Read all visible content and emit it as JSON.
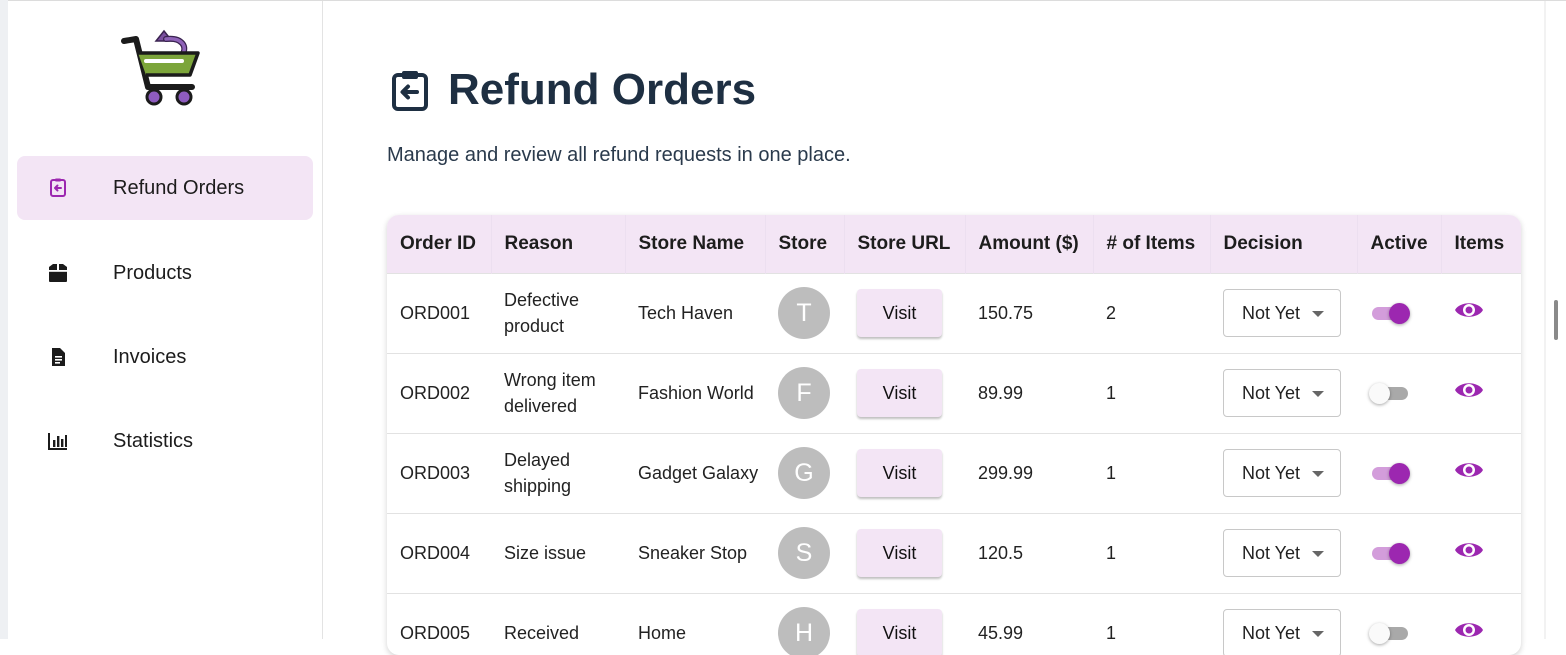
{
  "sidebar": {
    "items": [
      {
        "label": "Refund Orders",
        "icon": "refund-icon",
        "active": true
      },
      {
        "label": "Products",
        "icon": "box-icon",
        "active": false
      },
      {
        "label": "Invoices",
        "icon": "invoice-icon",
        "active": false
      },
      {
        "label": "Statistics",
        "icon": "bar-chart-icon",
        "active": false
      }
    ]
  },
  "header": {
    "title": "Refund Orders",
    "subtitle": "Manage and review all refund requests in one place."
  },
  "table": {
    "columns": [
      "Order ID",
      "Reason",
      "Store Name",
      "Store",
      "Store URL",
      "Amount ($)",
      "# of Items",
      "Decision",
      "Active",
      "Items"
    ],
    "visit_label": "Visit",
    "rows": [
      {
        "order_id": "ORD001",
        "reason": "Defective product",
        "store_name": "Tech Haven",
        "store_initial": "T",
        "amount": "150.75",
        "items": "2",
        "decision": "Not Yet",
        "active": true
      },
      {
        "order_id": "ORD002",
        "reason": "Wrong item delivered",
        "store_name": "Fashion World",
        "store_initial": "F",
        "amount": "89.99",
        "items": "1",
        "decision": "Not Yet",
        "active": false
      },
      {
        "order_id": "ORD003",
        "reason": "Delayed shipping",
        "store_name": "Gadget Galaxy",
        "store_initial": "G",
        "amount": "299.99",
        "items": "1",
        "decision": "Not Yet",
        "active": true
      },
      {
        "order_id": "ORD004",
        "reason": "Size issue",
        "store_name": "Sneaker Stop",
        "store_initial": "S",
        "amount": "120.5",
        "items": "1",
        "decision": "Not Yet",
        "active": true
      },
      {
        "order_id": "ORD005",
        "reason": "Received",
        "store_name": "Home",
        "store_initial": "H",
        "amount": "45.99",
        "items": "1",
        "decision": "Not Yet",
        "active": false
      }
    ]
  },
  "colors": {
    "accent": "#9c27b0",
    "accent_light": "#f3e5f5",
    "title": "#1e2f42",
    "avatar": "#bdbdbd"
  }
}
